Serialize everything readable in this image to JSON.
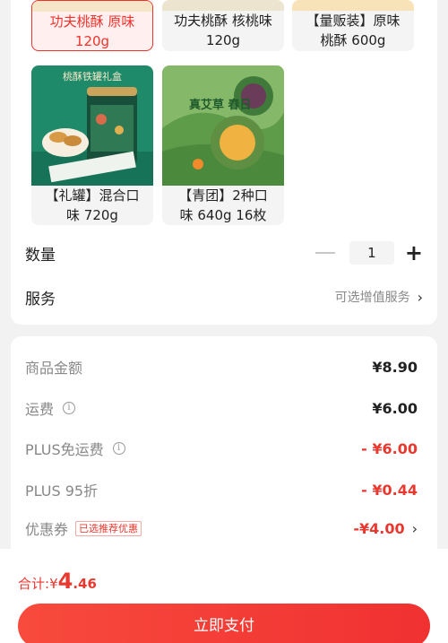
{
  "variants_top": [
    {
      "label_line1": "功夫桃酥 原味",
      "label_line2": "120g",
      "selected": true
    },
    {
      "label_line1": "功夫桃酥 核桃味",
      "label_line2": "120g",
      "selected": false
    },
    {
      "label_line1": "【量贩装】原味",
      "label_line2": "桃酥 600g",
      "selected": false
    }
  ],
  "variants_image": [
    {
      "label_line1": "【礼罐】混合口",
      "label_line2": "味 720g",
      "image_text": "桃酥铁罐礼盒"
    },
    {
      "label_line1": "【青团】2种口",
      "label_line2": "味 640g 16枚",
      "image_text": "真艾草 春日"
    }
  ],
  "quantity": {
    "label": "数量",
    "value": "1",
    "minus": "−",
    "plus": "+"
  },
  "service": {
    "label": "服务",
    "hint": "可选增值服务",
    "chevron": "›"
  },
  "price_rows": {
    "goods": {
      "label": "商品金额",
      "value": "¥8.90"
    },
    "shipping": {
      "label": "运费",
      "value": "¥6.00",
      "info": "i"
    },
    "plus_free": {
      "label": "PLUS免运费",
      "value": "- ¥6.00",
      "info": "i"
    },
    "plus_discount": {
      "label": "PLUS 95折",
      "value": "- ¥0.44"
    },
    "coupon": {
      "label": "优惠券",
      "tag": "已选推荐优惠",
      "value": "-¥4.00",
      "chevron": "›"
    }
  },
  "footer": {
    "total_label": "合计: ",
    "currency": "¥",
    "integer": "4",
    "decimal": ".46",
    "pay_button": "立即支付"
  },
  "colors": {
    "accent": "#f0312c",
    "price_red": "#e8382f"
  }
}
